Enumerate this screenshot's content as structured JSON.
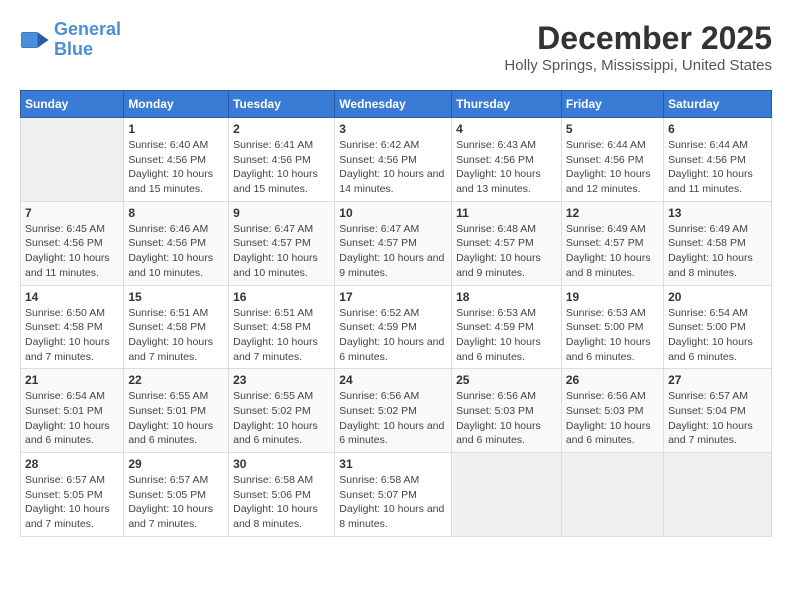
{
  "logo": {
    "line1": "General",
    "line2": "Blue"
  },
  "title": "December 2025",
  "subtitle": "Holly Springs, Mississippi, United States",
  "days_header": [
    "Sunday",
    "Monday",
    "Tuesday",
    "Wednesday",
    "Thursday",
    "Friday",
    "Saturday"
  ],
  "weeks": [
    [
      {
        "day": "",
        "sunrise": "",
        "sunset": "",
        "daylight": ""
      },
      {
        "day": "1",
        "sunrise": "6:40 AM",
        "sunset": "4:56 PM",
        "daylight": "10 hours and 15 minutes."
      },
      {
        "day": "2",
        "sunrise": "6:41 AM",
        "sunset": "4:56 PM",
        "daylight": "10 hours and 15 minutes."
      },
      {
        "day": "3",
        "sunrise": "6:42 AM",
        "sunset": "4:56 PM",
        "daylight": "10 hours and 14 minutes."
      },
      {
        "day": "4",
        "sunrise": "6:43 AM",
        "sunset": "4:56 PM",
        "daylight": "10 hours and 13 minutes."
      },
      {
        "day": "5",
        "sunrise": "6:44 AM",
        "sunset": "4:56 PM",
        "daylight": "10 hours and 12 minutes."
      },
      {
        "day": "6",
        "sunrise": "6:44 AM",
        "sunset": "4:56 PM",
        "daylight": "10 hours and 11 minutes."
      }
    ],
    [
      {
        "day": "7",
        "sunrise": "6:45 AM",
        "sunset": "4:56 PM",
        "daylight": "10 hours and 11 minutes."
      },
      {
        "day": "8",
        "sunrise": "6:46 AM",
        "sunset": "4:56 PM",
        "daylight": "10 hours and 10 minutes."
      },
      {
        "day": "9",
        "sunrise": "6:47 AM",
        "sunset": "4:57 PM",
        "daylight": "10 hours and 10 minutes."
      },
      {
        "day": "10",
        "sunrise": "6:47 AM",
        "sunset": "4:57 PM",
        "daylight": "10 hours and 9 minutes."
      },
      {
        "day": "11",
        "sunrise": "6:48 AM",
        "sunset": "4:57 PM",
        "daylight": "10 hours and 9 minutes."
      },
      {
        "day": "12",
        "sunrise": "6:49 AM",
        "sunset": "4:57 PM",
        "daylight": "10 hours and 8 minutes."
      },
      {
        "day": "13",
        "sunrise": "6:49 AM",
        "sunset": "4:58 PM",
        "daylight": "10 hours and 8 minutes."
      }
    ],
    [
      {
        "day": "14",
        "sunrise": "6:50 AM",
        "sunset": "4:58 PM",
        "daylight": "10 hours and 7 minutes."
      },
      {
        "day": "15",
        "sunrise": "6:51 AM",
        "sunset": "4:58 PM",
        "daylight": "10 hours and 7 minutes."
      },
      {
        "day": "16",
        "sunrise": "6:51 AM",
        "sunset": "4:58 PM",
        "daylight": "10 hours and 7 minutes."
      },
      {
        "day": "17",
        "sunrise": "6:52 AM",
        "sunset": "4:59 PM",
        "daylight": "10 hours and 6 minutes."
      },
      {
        "day": "18",
        "sunrise": "6:53 AM",
        "sunset": "4:59 PM",
        "daylight": "10 hours and 6 minutes."
      },
      {
        "day": "19",
        "sunrise": "6:53 AM",
        "sunset": "5:00 PM",
        "daylight": "10 hours and 6 minutes."
      },
      {
        "day": "20",
        "sunrise": "6:54 AM",
        "sunset": "5:00 PM",
        "daylight": "10 hours and 6 minutes."
      }
    ],
    [
      {
        "day": "21",
        "sunrise": "6:54 AM",
        "sunset": "5:01 PM",
        "daylight": "10 hours and 6 minutes."
      },
      {
        "day": "22",
        "sunrise": "6:55 AM",
        "sunset": "5:01 PM",
        "daylight": "10 hours and 6 minutes."
      },
      {
        "day": "23",
        "sunrise": "6:55 AM",
        "sunset": "5:02 PM",
        "daylight": "10 hours and 6 minutes."
      },
      {
        "day": "24",
        "sunrise": "6:56 AM",
        "sunset": "5:02 PM",
        "daylight": "10 hours and 6 minutes."
      },
      {
        "day": "25",
        "sunrise": "6:56 AM",
        "sunset": "5:03 PM",
        "daylight": "10 hours and 6 minutes."
      },
      {
        "day": "26",
        "sunrise": "6:56 AM",
        "sunset": "5:03 PM",
        "daylight": "10 hours and 6 minutes."
      },
      {
        "day": "27",
        "sunrise": "6:57 AM",
        "sunset": "5:04 PM",
        "daylight": "10 hours and 7 minutes."
      }
    ],
    [
      {
        "day": "28",
        "sunrise": "6:57 AM",
        "sunset": "5:05 PM",
        "daylight": "10 hours and 7 minutes."
      },
      {
        "day": "29",
        "sunrise": "6:57 AM",
        "sunset": "5:05 PM",
        "daylight": "10 hours and 7 minutes."
      },
      {
        "day": "30",
        "sunrise": "6:58 AM",
        "sunset": "5:06 PM",
        "daylight": "10 hours and 8 minutes."
      },
      {
        "day": "31",
        "sunrise": "6:58 AM",
        "sunset": "5:07 PM",
        "daylight": "10 hours and 8 minutes."
      },
      {
        "day": "",
        "sunrise": "",
        "sunset": "",
        "daylight": ""
      },
      {
        "day": "",
        "sunrise": "",
        "sunset": "",
        "daylight": ""
      },
      {
        "day": "",
        "sunrise": "",
        "sunset": "",
        "daylight": ""
      }
    ]
  ],
  "labels": {
    "sunrise_prefix": "Sunrise: ",
    "sunset_prefix": "Sunset: ",
    "daylight_prefix": "Daylight: "
  }
}
